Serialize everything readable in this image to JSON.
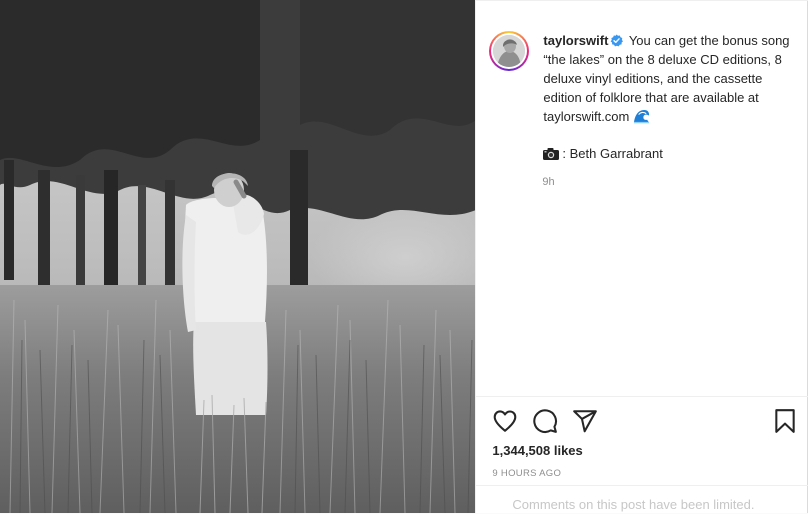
{
  "post": {
    "username": "taylorswift",
    "verified_icon": "verified-badge-icon",
    "caption": "You can get the bonus song “the lakes” on the 8 deluxe CD editions, 8 deluxe vinyl editions, and the cassette edition of folklore that are available at taylorswift.com",
    "caption_emoji": "wave-emoji",
    "photo_credit": ": Beth Garrabrant",
    "relative_time": "9h",
    "likes": "1,344,508 likes",
    "timestamp": "9 HOURS AGO",
    "comments_notice": "Comments on this post have been limited."
  },
  "actions": {
    "like_icon": "heart-icon",
    "comment_icon": "comment-icon",
    "share_icon": "share-icon",
    "save_icon": "bookmark-icon"
  },
  "colors": {
    "text": "#262626",
    "muted": "#8e8e8e",
    "verified": "#3897f0",
    "border": "#efefef"
  }
}
